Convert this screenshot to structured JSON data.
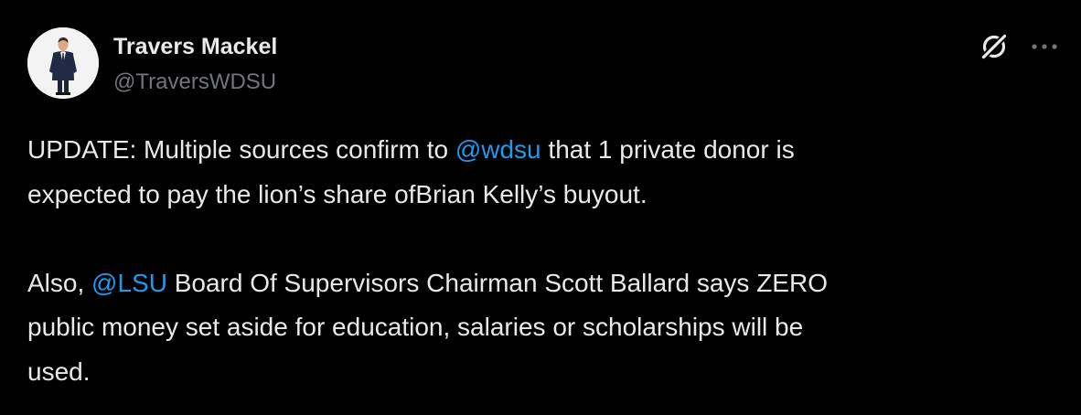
{
  "author": {
    "name": "Travers Mackel",
    "handle": "@TraversWDSU"
  },
  "tweet": {
    "p1_before": "UPDATE: Multiple sources confirm to ",
    "p1_mention": "@wdsu",
    "p1_after_l1": " that 1 private donor is",
    "p1_line2": "expected to pay the lion’s share ofBrian Kelly’s buyout.",
    "p2_before": "Also, ",
    "p2_mention": "@LSU",
    "p2_after_l1": " Board Of Supervisors Chairman Scott Ballard says ZERO",
    "p2_line2": "public money set aside for education, salaries or scholarships will be",
    "p2_line3": "used."
  },
  "icons": {
    "grok": "grok-icon",
    "more": "more-options-icon"
  },
  "colors": {
    "background": "#000000",
    "text": "#e7e9ea",
    "secondary": "#71767b",
    "link": "#1d9bf0"
  }
}
